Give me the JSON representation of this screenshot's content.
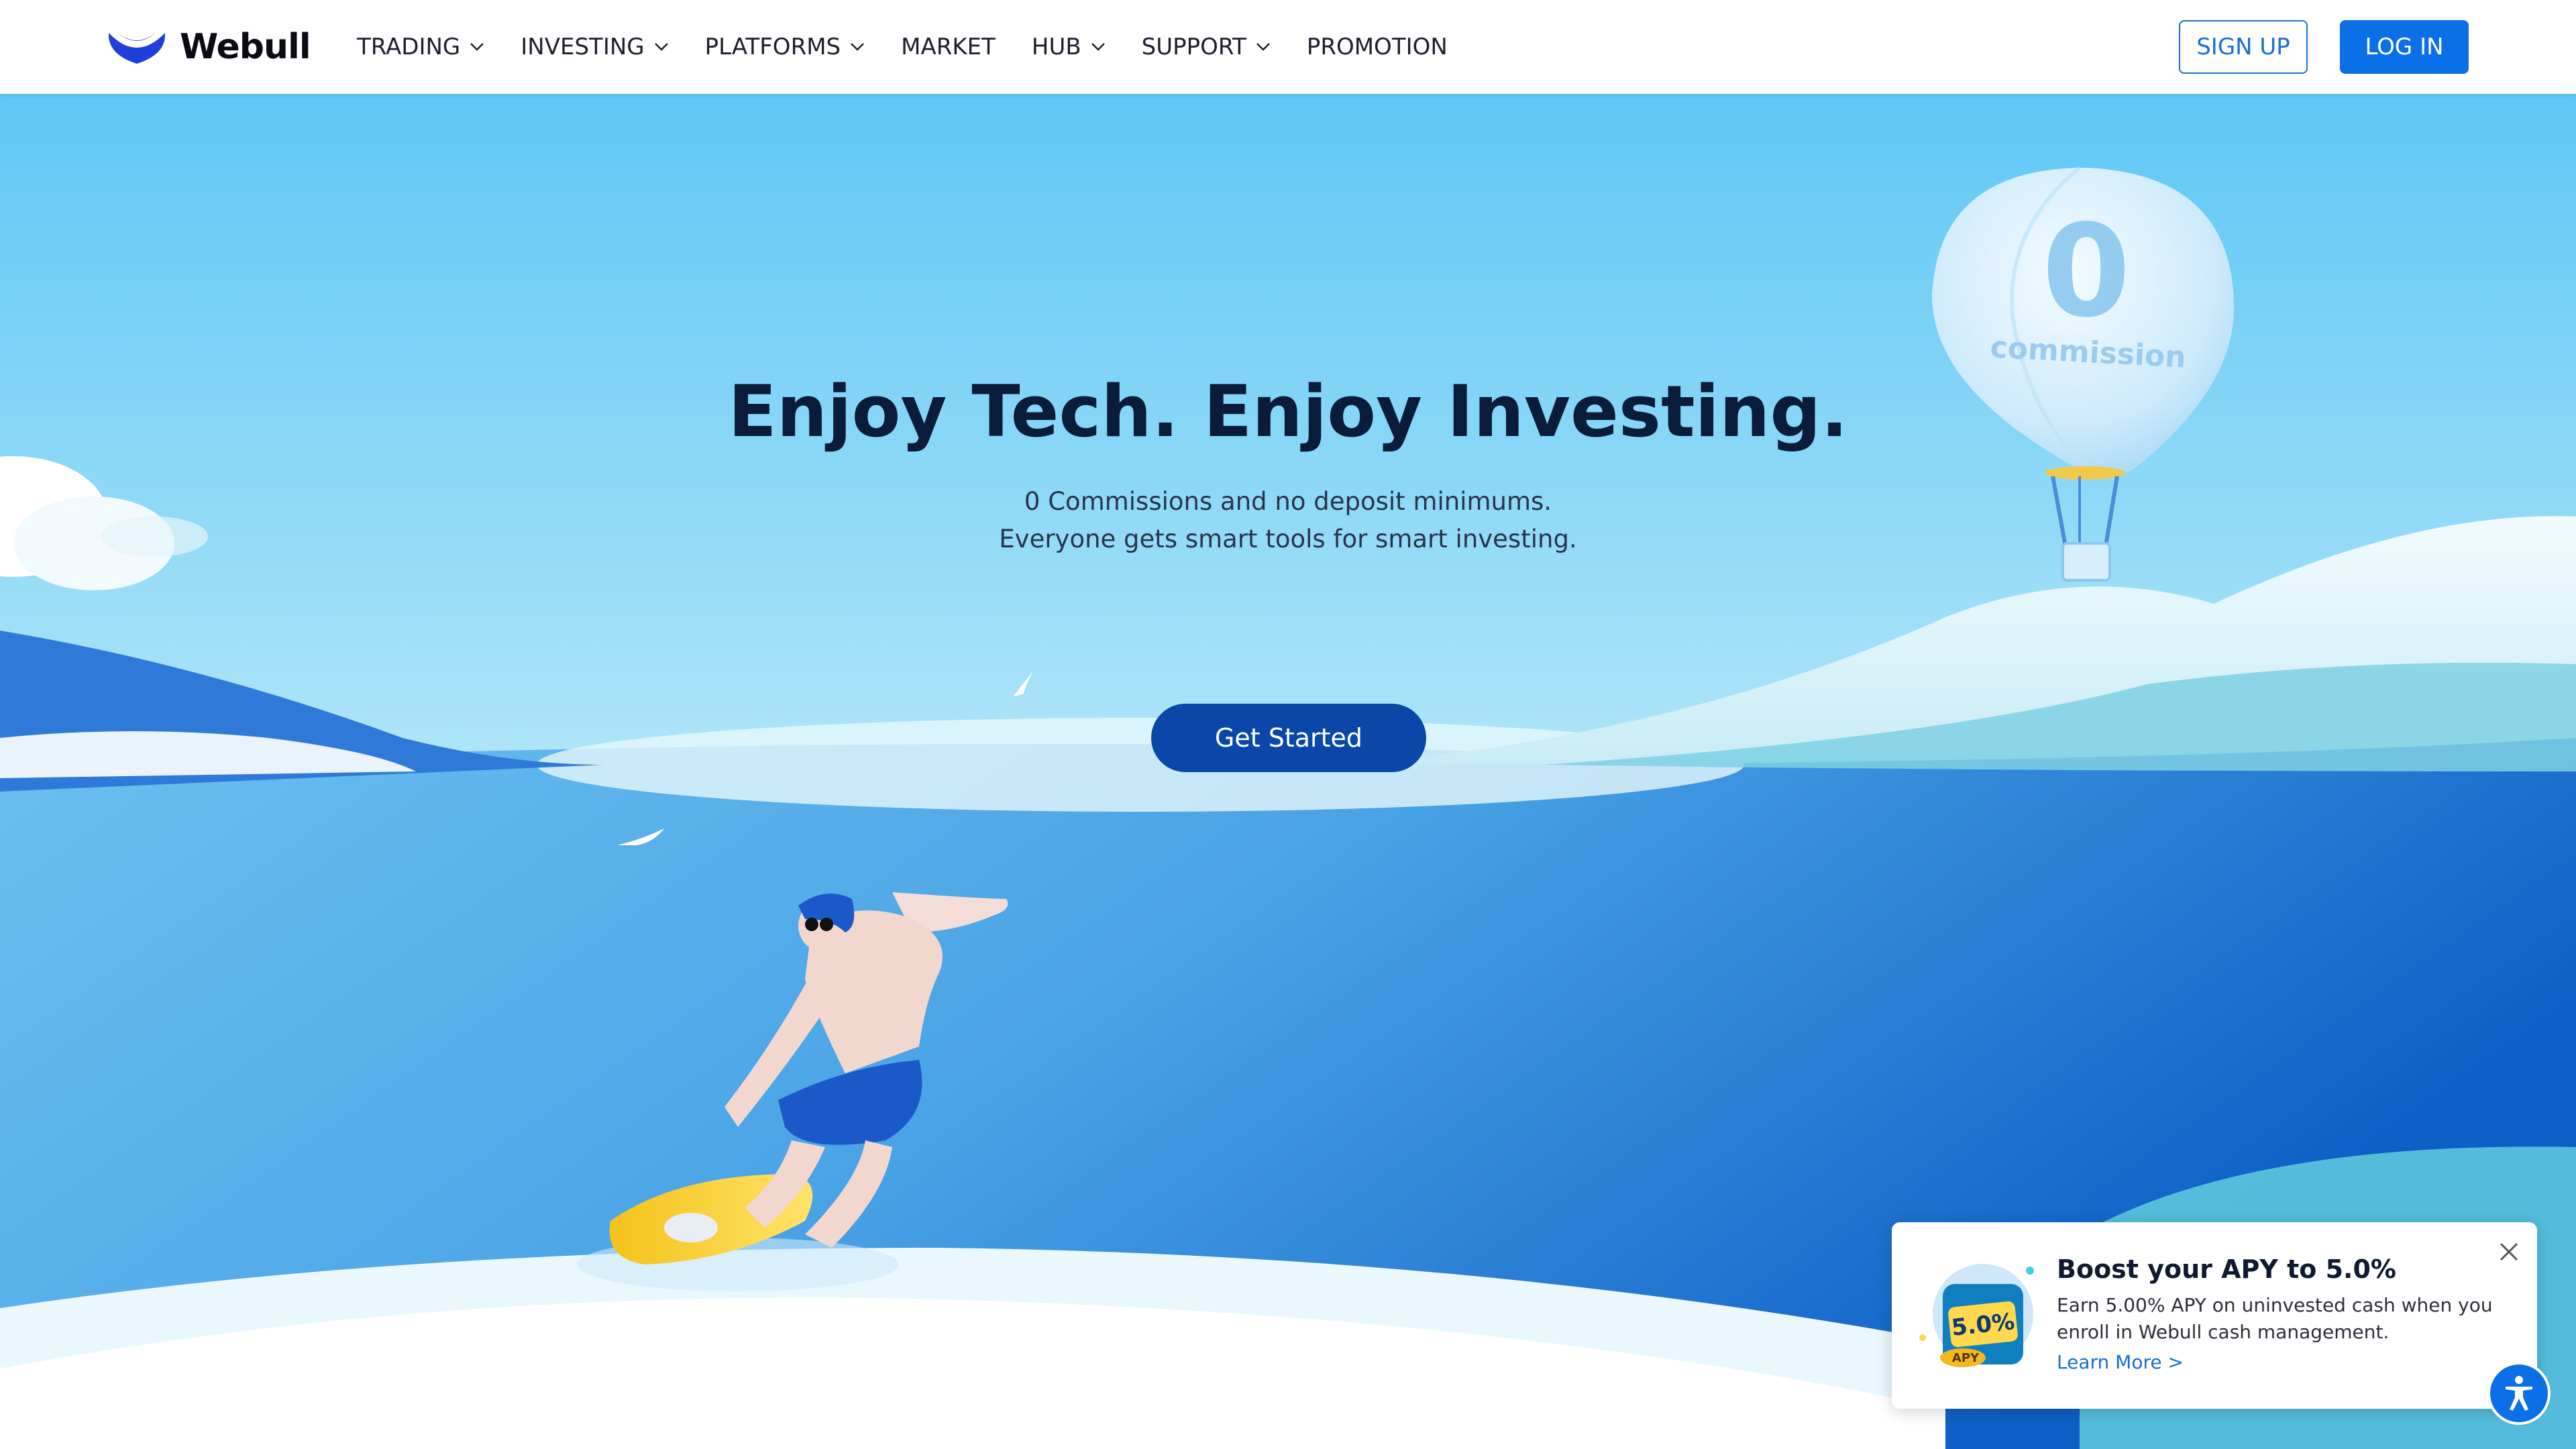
{
  "brand": {
    "name": "Webull",
    "accent": "#0b6fe8",
    "logo_color": "#1f3fd9"
  },
  "nav": {
    "items": [
      {
        "label": "TRADING",
        "has_dropdown": true
      },
      {
        "label": "INVESTING",
        "has_dropdown": true
      },
      {
        "label": "PLATFORMS",
        "has_dropdown": true
      },
      {
        "label": "MARKET",
        "has_dropdown": false
      },
      {
        "label": "HUB",
        "has_dropdown": true
      },
      {
        "label": "SUPPORT",
        "has_dropdown": true
      },
      {
        "label": "PROMOTION",
        "has_dropdown": false
      }
    ],
    "signup_label": "SIGN UP",
    "login_label": "LOG IN"
  },
  "hero": {
    "title": "Enjoy Tech. Enjoy Investing.",
    "subtitle_line1": "0 Commissions and no deposit minimums.",
    "subtitle_line2": "Everyone gets smart tools for smart investing.",
    "cta_label": "Get Started",
    "balloon_number": "0",
    "balloon_text": "commission"
  },
  "popup": {
    "title": "Boost your APY to 5.0%",
    "body": "Earn 5.00% APY on uninvested cash when you enroll in Webull cash management.",
    "link": "Learn More >",
    "badge_value": "5.0%",
    "badge_label": "APY"
  },
  "icons": {
    "close": "close-icon",
    "accessibility": "accessibility-icon",
    "chevron": "chevron-down-icon"
  }
}
